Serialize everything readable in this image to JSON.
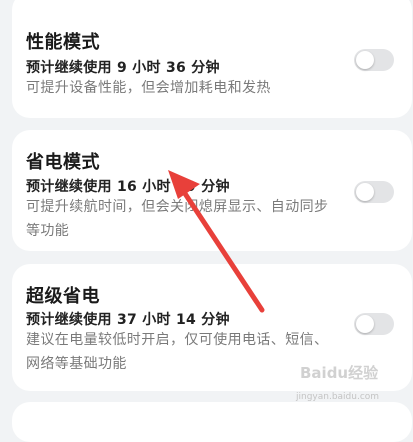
{
  "settings": [
    {
      "title": "性能模式",
      "estimate": "预计继续使用 9 小时 36 分钟",
      "description": "可提升设备性能，但会增加耗电和发热",
      "enabled": false
    },
    {
      "title": "省电模式",
      "estimate": "预计继续使用 16 小时 49 分钟",
      "description": "可提升续航时间，但会关闭熄屏显示、自动同步等功能",
      "enabled": false
    },
    {
      "title": "超级省电",
      "estimate": "预计继续使用 37 小时 14 分钟",
      "description": "建议在电量较低时开启，仅可使用电话、短信、网络等基础功能",
      "enabled": false
    }
  ],
  "annotation": {
    "color": "#e8403a"
  },
  "watermark": {
    "text": "Baidu经验",
    "url": "jingyan.baidu.com"
  }
}
